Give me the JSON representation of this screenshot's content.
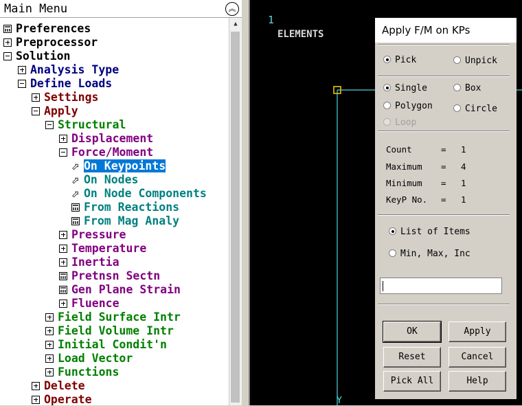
{
  "main_menu": {
    "title": "Main Menu",
    "items": [
      {
        "label": "Preferences",
        "color": "#000000"
      },
      {
        "label": "Preprocessor",
        "color": "#000000"
      },
      {
        "label": "Solution",
        "color": "#000000"
      },
      {
        "label": "Analysis Type",
        "color": "#000080"
      },
      {
        "label": "Define Loads",
        "color": "#000080"
      },
      {
        "label": "Settings",
        "color": "#800000"
      },
      {
        "label": "Apply",
        "color": "#800000"
      },
      {
        "label": "Structural",
        "color": "#008000"
      },
      {
        "label": "Displacement",
        "color": "#800080"
      },
      {
        "label": "Force/Moment",
        "color": "#800080"
      },
      {
        "label": "On Keypoints",
        "color": "#008080"
      },
      {
        "label": "On Nodes",
        "color": "#008080"
      },
      {
        "label": "On Node Components",
        "color": "#008080"
      },
      {
        "label": "From Reactions",
        "color": "#008080"
      },
      {
        "label": "From Mag Analy",
        "color": "#008080"
      },
      {
        "label": "Pressure",
        "color": "#800080"
      },
      {
        "label": "Temperature",
        "color": "#800080"
      },
      {
        "label": "Inertia",
        "color": "#800080"
      },
      {
        "label": "Pretnsn Sectn",
        "color": "#800080"
      },
      {
        "label": "Gen Plane Strain",
        "color": "#800080"
      },
      {
        "label": "Fluence",
        "color": "#800080"
      },
      {
        "label": "Field Surface Intr",
        "color": "#008000"
      },
      {
        "label": "Field Volume Intr",
        "color": "#008000"
      },
      {
        "label": "Initial Condit'n",
        "color": "#008000"
      },
      {
        "label": "Load Vector",
        "color": "#008000"
      },
      {
        "label": "Functions",
        "color": "#008000"
      },
      {
        "label": "Delete",
        "color": "#800000"
      },
      {
        "label": "Operate",
        "color": "#800000"
      }
    ]
  },
  "graphics": {
    "window_number": "1",
    "label": "ELEMENTS",
    "axis_label": "Y"
  },
  "dialog": {
    "title": "Apply F/M on KPs",
    "mode": {
      "pick": "Pick",
      "unpick": "Unpick",
      "selected": "Pick"
    },
    "shape": {
      "single": "Single",
      "box": "Box",
      "polygon": "Polygon",
      "circle": "Circle",
      "loop": "Loop",
      "selected": "Single"
    },
    "info": {
      "count_label": "Count",
      "count": "1",
      "max_label": "Maximum",
      "max": "4",
      "min_label": "Minimum",
      "min": "1",
      "keyp_label": "KeyP No.",
      "keyp": "1"
    },
    "entry": {
      "list": "List of Items",
      "range": "Min, Max, Inc",
      "selected": "List of Items"
    },
    "input_value": "",
    "buttons": {
      "ok": "OK",
      "apply": "Apply",
      "reset": "Reset",
      "cancel": "Cancel",
      "pick_all": "Pick All",
      "help": "Help"
    }
  }
}
